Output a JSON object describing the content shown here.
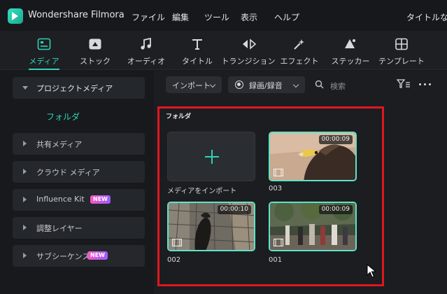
{
  "app": {
    "name": "Wondershare Filmora",
    "right_label": "タイトルなし"
  },
  "menu": {
    "items": [
      "ファイル",
      "編集",
      "ツール",
      "表示",
      "ヘルプ"
    ]
  },
  "toolbar": {
    "items": [
      {
        "label": "メディア",
        "icon": "media-icon",
        "active": true
      },
      {
        "label": "ストック",
        "icon": "stock-icon"
      },
      {
        "label": "オーディオ",
        "icon": "audio-icon"
      },
      {
        "label": "タイトル",
        "icon": "title-icon"
      },
      {
        "label": "トランジション",
        "icon": "transition-icon"
      },
      {
        "label": "エフェクト",
        "icon": "effect-icon"
      },
      {
        "label": "ステッカー",
        "icon": "sticker-icon"
      },
      {
        "label": "テンプレート",
        "icon": "template-icon"
      }
    ],
    "accent": "#2ed3b7"
  },
  "sidebar": {
    "items": [
      {
        "label": "プロジェクトメディア",
        "expanded": true
      },
      {
        "label": "共有メディア"
      },
      {
        "label": "クラウド メディア"
      },
      {
        "label": "Influence Kit",
        "badge": "NEW"
      },
      {
        "label": "調整レイヤー"
      },
      {
        "label": "サブシーケンス",
        "badge": "NEW"
      }
    ],
    "folder": "フォルダ"
  },
  "content": {
    "import_dropdown": "インポート",
    "record_dropdown": "録画/録音",
    "search_placeholder": "検索",
    "panel_title": "フォルダ",
    "import_tile_label": "メディアをインポート",
    "clips": [
      {
        "name": "003",
        "duration": "00:00:09"
      },
      {
        "name": "002",
        "duration": "00:00:10"
      },
      {
        "name": "001",
        "duration": "00:00:09"
      }
    ],
    "highlight_color": "#e0161f"
  }
}
